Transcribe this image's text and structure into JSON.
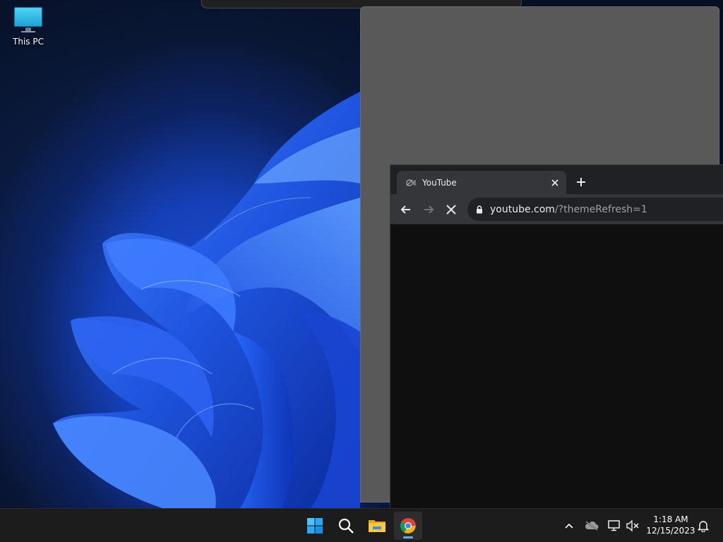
{
  "desktop": {
    "icons": [
      {
        "label": "This PC",
        "icon": "monitor-icon"
      }
    ]
  },
  "browser": {
    "tabs": [
      {
        "title": "YouTube",
        "favicon": "muted-audio-icon",
        "active": true
      }
    ],
    "new_tab_icon": "plus-icon",
    "nav": {
      "back_icon": "arrow-left-icon",
      "forward_icon": "arrow-right-icon",
      "stop_icon": "close-icon"
    },
    "omnibox": {
      "domain": "youtube.com",
      "path": "/?themeRefresh=1",
      "security_icon": "lock-icon"
    }
  },
  "taskbar": {
    "apps": [
      {
        "name": "Start",
        "icon": "windows-logo-icon"
      },
      {
        "name": "Search",
        "icon": "search-icon"
      },
      {
        "name": "File Explorer",
        "icon": "folder-icon"
      },
      {
        "name": "Google Chrome",
        "icon": "chrome-icon",
        "running": true
      }
    ],
    "tray": {
      "icons": [
        "chevron-up-icon",
        "onedrive-offline-icon",
        "network-icon",
        "volume-muted-icon"
      ],
      "time": "1:18 AM",
      "date": "12/15/2023",
      "notification_icon": "bell-icon"
    }
  },
  "colors": {
    "accent": "#5fb2f2",
    "taskbar": "#1c1c1c",
    "chrome_toolbar": "#35363a",
    "chrome_tabstrip": "#202124",
    "page_bg": "#0f0f0f"
  }
}
